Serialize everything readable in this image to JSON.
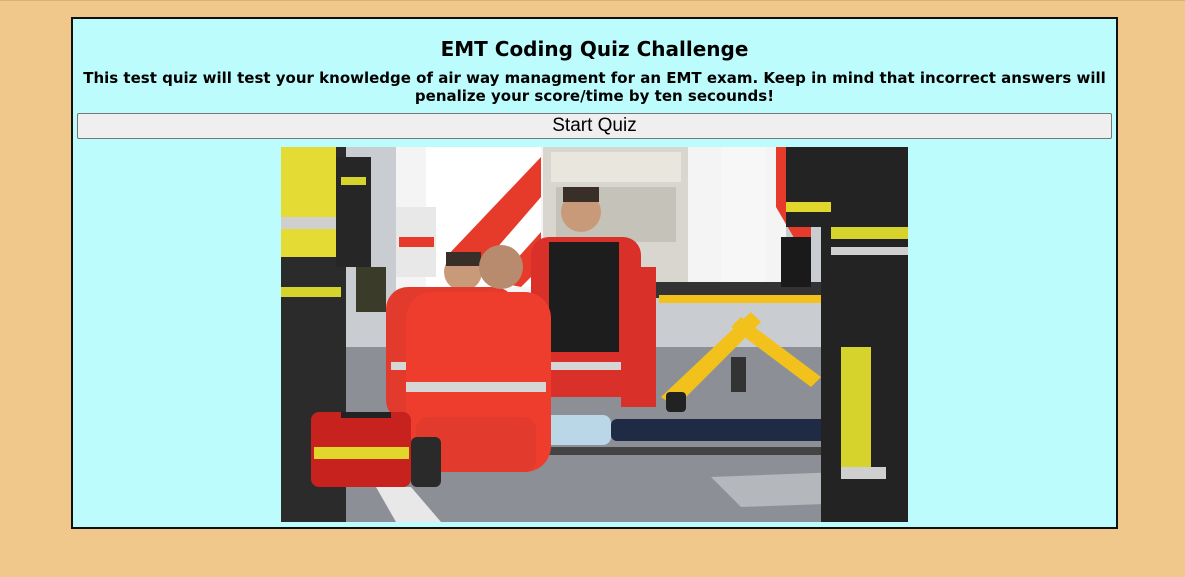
{
  "quiz": {
    "title": "EMT Coding Quiz Challenge",
    "description": "This test quiz will test your knowledge of air way managment for an EMT exam. Keep in mind that incorrect answers will penalize your score/time by ten secounds!",
    "start_button_label": "Start Quiz"
  },
  "image": {
    "subject": "paramedics-treating-patient-photo"
  },
  "colors": {
    "page_background": "#f0c88c",
    "card_background": "#bdfcfc",
    "card_border": "#111111",
    "button_background": "#efefef"
  }
}
